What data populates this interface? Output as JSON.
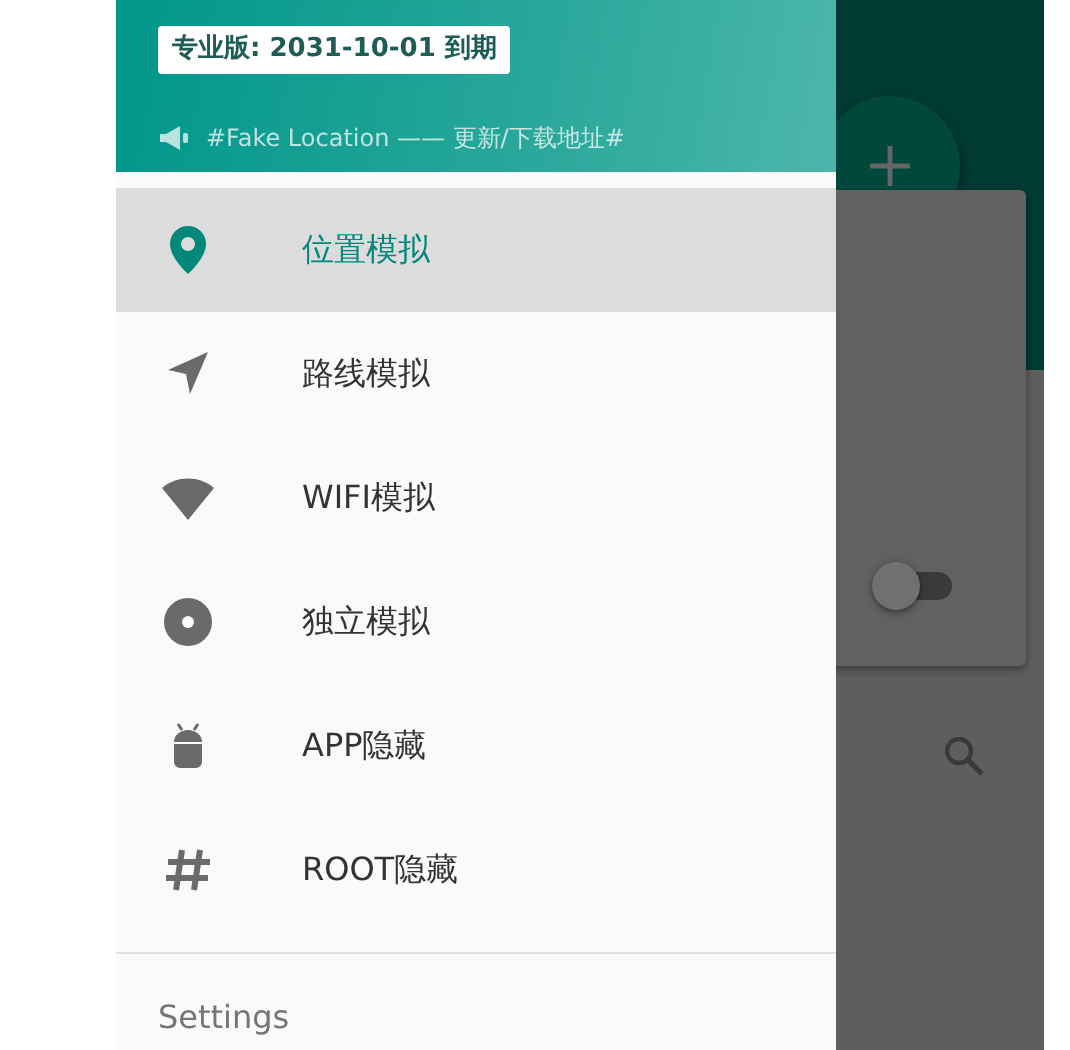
{
  "drawer": {
    "header": {
      "license_badge": "专业版: 2031-10-01 到期",
      "announcement": "#Fake Location —— 更新/下载地址#"
    },
    "menu_items": [
      {
        "label": "位置模拟",
        "selected": true
      },
      {
        "label": "路线模拟",
        "selected": false
      },
      {
        "label": "WIFI模拟",
        "selected": false
      },
      {
        "label": "独立模拟",
        "selected": false
      },
      {
        "label": "APP隐藏",
        "selected": false
      },
      {
        "label": "ROOT隐藏",
        "selected": false
      }
    ],
    "footer": {
      "label": "Settings"
    }
  },
  "background": {
    "switch": {
      "on": false
    }
  }
}
